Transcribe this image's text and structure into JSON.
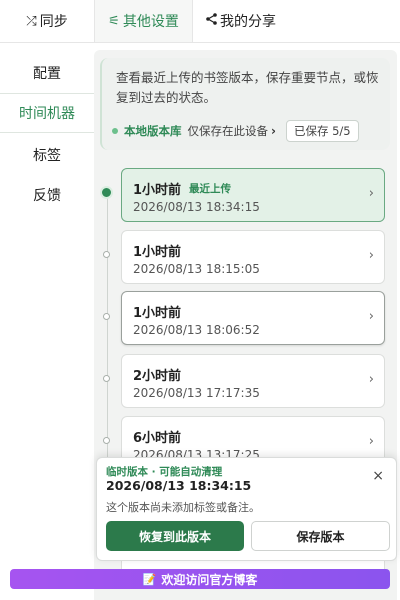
{
  "tabs": {
    "sync": {
      "icon": "⤮",
      "label": "同步"
    },
    "settings": {
      "icon": "⚟",
      "label": "其他设置"
    },
    "share": {
      "icon": "≺",
      "label": "我的分享"
    }
  },
  "sidebar": {
    "items": [
      {
        "label": "配置"
      },
      {
        "label": "时间机器",
        "active": true
      },
      {
        "label": "标签"
      },
      {
        "label": "反馈"
      }
    ]
  },
  "info": {
    "text": "查看最近上传的书签版本，保存重要节点，或恢复到过去的状态。",
    "library_label": "本地版本库",
    "local_note": "仅保存在此设备",
    "chevron": "›",
    "saved_badge": "已保存 5/5"
  },
  "versions": [
    {
      "ago": "1小时前",
      "tag": "最近上传",
      "datetime": "2026/08/13 18:34:15"
    },
    {
      "ago": "1小时前",
      "tag": "",
      "datetime": "2026/08/13 18:15:05"
    },
    {
      "ago": "1小时前",
      "tag": "",
      "datetime": "2026/08/13 18:06:52"
    },
    {
      "ago": "2小时前",
      "tag": "",
      "datetime": "2026/08/13 17:17:35"
    },
    {
      "ago": "6小时前",
      "tag": "",
      "datetime": "2026/08/13 13:17:25"
    }
  ],
  "card_chevron": "›",
  "popup": {
    "subtitle": "临时版本 · 可能自动清理",
    "time": "2026/08/13 18:34:15",
    "note": "这个版本尚未添加标签或备注。",
    "close": "×",
    "restore_label": "恢复到此版本",
    "save_label": "保存版本"
  },
  "banner": {
    "icon": "📝",
    "text": "欢迎访问官方博客"
  },
  "colors": {
    "accent": "#2f8a57",
    "banner_start": "#a654f0",
    "banner_end": "#8b54ee"
  }
}
